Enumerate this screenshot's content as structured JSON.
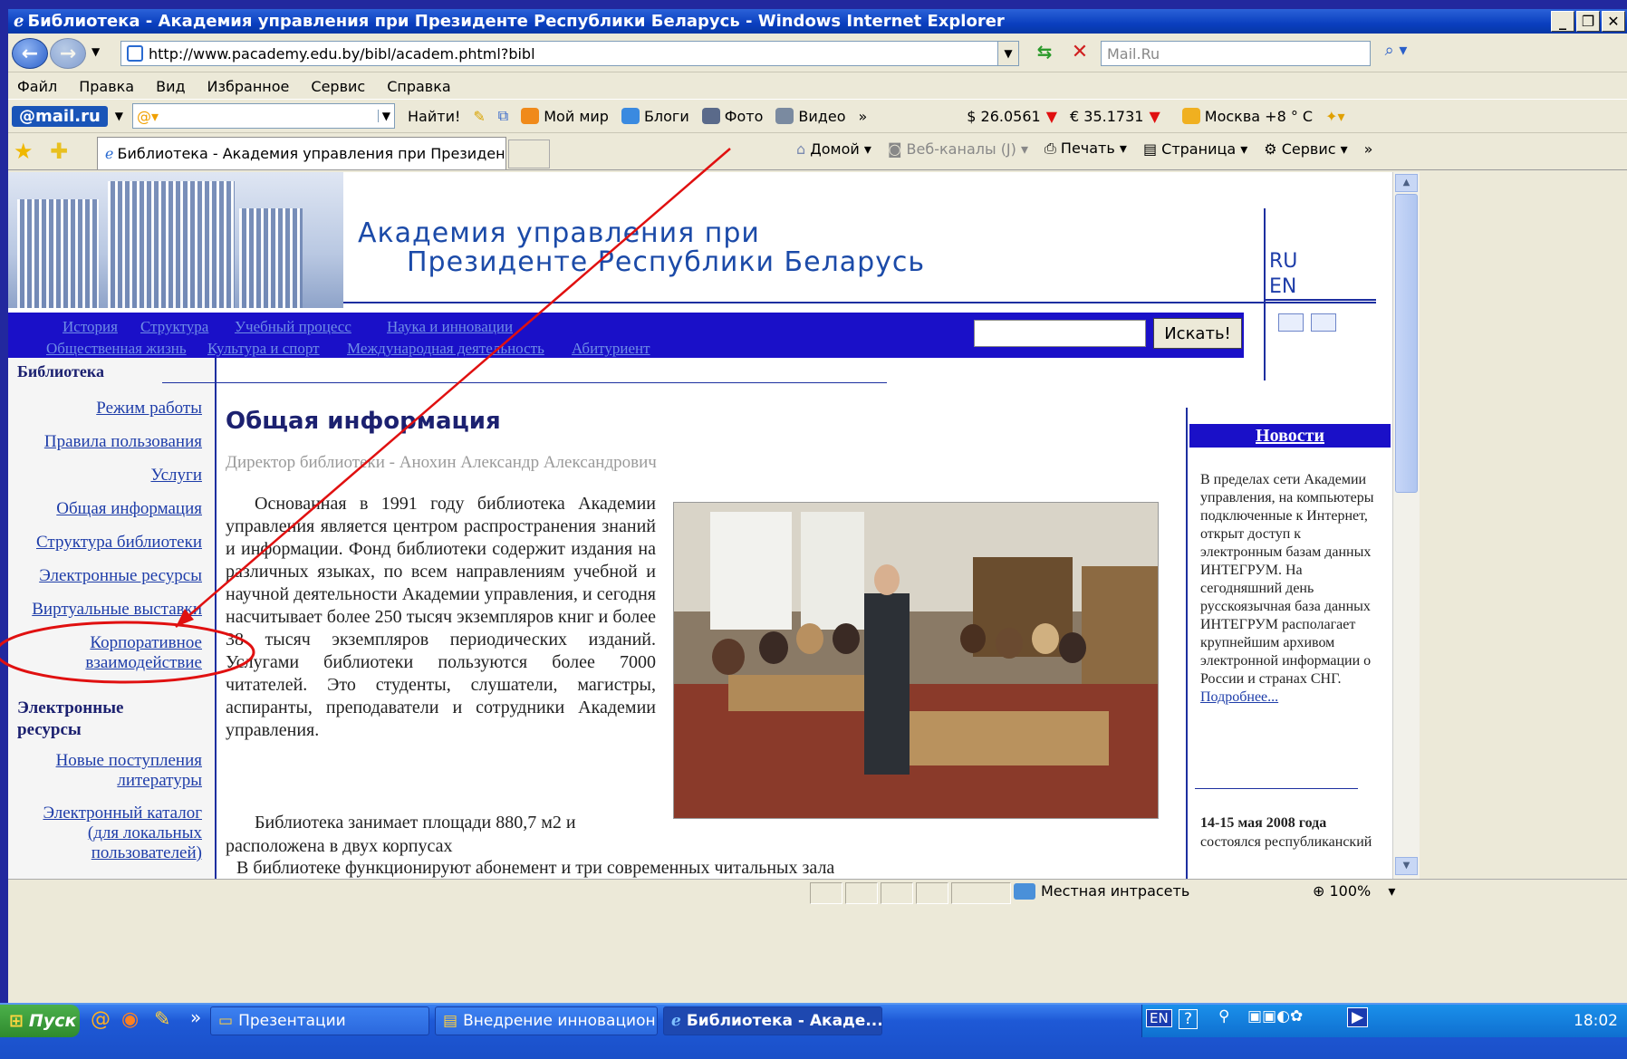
{
  "window": {
    "title": "Библиотека - Академия управления при Президенте Республики Беларусь - Windows Internet Explorer"
  },
  "address": {
    "url": "http://www.pacademy.edu.by/bibl/academ.phtml?bibl",
    "search_placeholder": "Mail.Ru"
  },
  "menu": [
    "Файл",
    "Правка",
    "Вид",
    "Избранное",
    "Сервис",
    "Справка"
  ],
  "mailbar": {
    "logo": "@mail.ru",
    "find": "Найти!",
    "items": [
      "Мой мир",
      "Блоги",
      "Фото",
      "Видео"
    ],
    "usd": "$ 26.0561",
    "eur": "€ 35.1731",
    "weather": "Москва +8 ° C"
  },
  "favbar": {
    "tab_title": "Библиотека - Академия управления при Президен...",
    "commands": [
      "Домой",
      "Веб-каналы (J)",
      "Печать",
      "Страница",
      "Сервис"
    ]
  },
  "site": {
    "name_line1": "Академия управления при",
    "name_line2": "Президенте Республики Беларусь",
    "lang_ru": "RU",
    "lang_en": "EN",
    "nav_row1": [
      "История",
      "Структура",
      "Учебный процесс",
      "Наука и инновации"
    ],
    "nav_row2": [
      "Общественная жизнь",
      "Культура и спорт",
      "Международная деятельность",
      "Абитуриент"
    ],
    "search_button": "Искать!"
  },
  "left": {
    "heading": "Библиотека",
    "items": [
      "Режим работы",
      "Правила пользования",
      "Услуги",
      "Общая информация",
      "Структура библиотеки",
      "Электронные ресурсы",
      "Виртуальные выставки",
      "Корпоративное",
      "взаимодействие"
    ],
    "heading2_line1": "Электронные",
    "heading2_line2": "ресурсы",
    "items2": [
      "Новые поступления",
      "литературы",
      "Электронный каталог",
      "(для локальных",
      "пользователей)"
    ]
  },
  "main": {
    "title": "Общая информация",
    "director": "Директор библиотеки - Анохин Александр Александрович",
    "para1": "Основанная в 1991 году библиотека Академии управления является центром распространения знаний и информации. Фонд библиотеки содержит издания на различных языках, по всем направлениям учебной и научной деятельности Академии управления, и сегодня насчитывает более 250 тысяч экземпляров книг и более 38 тысяч экземпляров периодических изданий. Услугами библиотеки пользуются более 7000 читателей. Это студенты, слушатели, магистры, аспиранты, преподаватели и сотрудники Академии управления.",
    "para2": "Библиотека занимает площади 880,7 м2 и расположена в двух корпусах",
    "para3": "В библиотеке функционируют абонемент и три современных читальных зала"
  },
  "news": {
    "heading": "Новости",
    "text": "В пределах сети Академии управления, на компьютеры подключенные к Интернет, открыт доступ к электронным базам данных ИНТЕГРУМ. На сегодняшний день русскоязычная база данных ИНТЕГРУМ располагает крупнейшим архивом электронной информации о России и странах СНГ.",
    "more": "Подробнее...",
    "date2": "14-15 мая 2008 года",
    "text2": "состоялся республиканский"
  },
  "status": {
    "zone": "Местная интрасеть",
    "zoom": "100%"
  },
  "taskbar": {
    "start": "Пуск",
    "tasks": [
      "Презентации",
      "Внедрение инновацион...",
      "Библиотека - Акаде..."
    ],
    "lang": "EN",
    "time": "18:02"
  },
  "colors": {
    "site_blue": "#1a10c8",
    "link": "#1e3da9",
    "annotation_red": "#e01010"
  }
}
